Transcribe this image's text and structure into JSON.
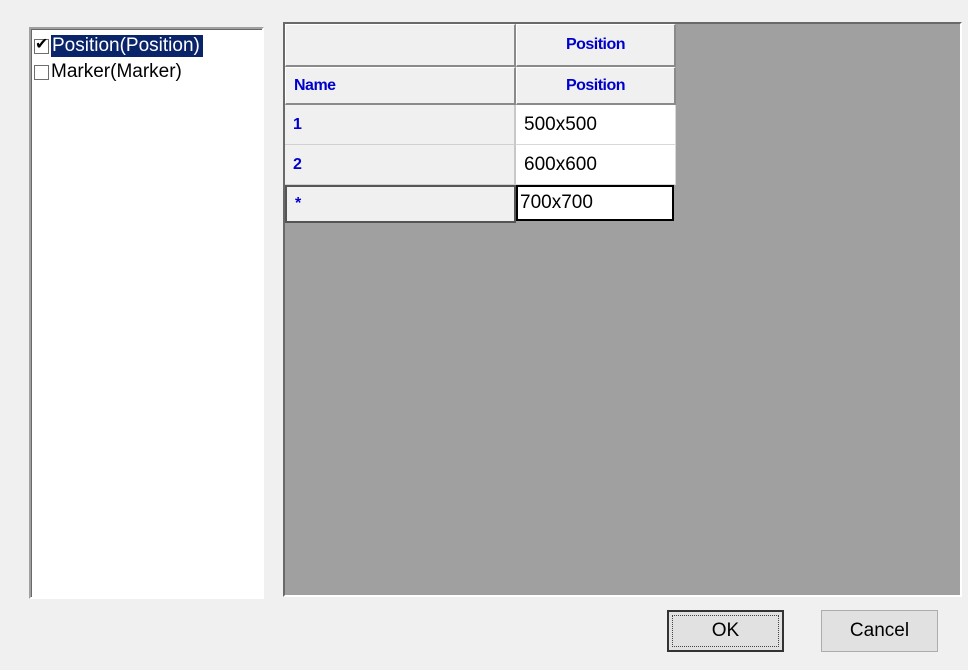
{
  "list": {
    "items": [
      {
        "label": "Position(Position)",
        "checked": true,
        "selected": true
      },
      {
        "label": "Marker(Marker)",
        "checked": false,
        "selected": false
      }
    ],
    "check_glyph": "✔"
  },
  "grid": {
    "group_header": "Position",
    "column_headers": [
      "Name",
      "Position"
    ],
    "rows": [
      {
        "name": "1",
        "position": "500x500"
      },
      {
        "name": "2",
        "position": "600x600"
      },
      {
        "name": "*",
        "position": "700x700"
      }
    ]
  },
  "buttons": {
    "ok": "OK",
    "cancel": "Cancel"
  },
  "colors": {
    "selection": "#0a246a",
    "header_text": "#0000cc",
    "grid_background": "#a0a0a0"
  }
}
